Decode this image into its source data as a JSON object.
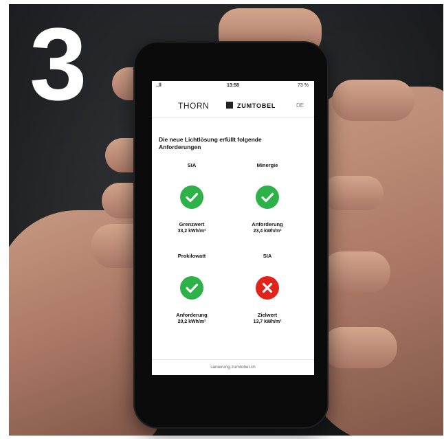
{
  "photo": {
    "step_number": "3"
  },
  "phone": {
    "status": {
      "signal": "..ll",
      "time": "13:58",
      "battery": "73 %"
    },
    "header": {
      "brand_left": "THORN",
      "brand_right": "ZUMTOBEL",
      "language": "DE"
    },
    "heading": "Die neue Lichtlösung erfüllt folgende Anforderungen",
    "requirements": [
      {
        "title": "SIA",
        "status": "ok",
        "caption": "Grenzwert",
        "value": "33,2 kWh/m²"
      },
      {
        "title": "Minergie",
        "status": "ok",
        "caption": "Anforderung",
        "value": "23,4 kWh/m²"
      },
      {
        "title": "Prokilowatt",
        "status": "ok",
        "caption": "Anforderung",
        "value": "20,2 kWh/m²"
      },
      {
        "title": "SIA",
        "status": "fail",
        "caption": "Zielwert",
        "value": "13,7 kWh/m²"
      }
    ],
    "footer_url": "sanierung.zumtobel.ch"
  },
  "colors": {
    "ok": "#2db24a",
    "fail": "#e2231a",
    "background": "#1c1d1f"
  }
}
